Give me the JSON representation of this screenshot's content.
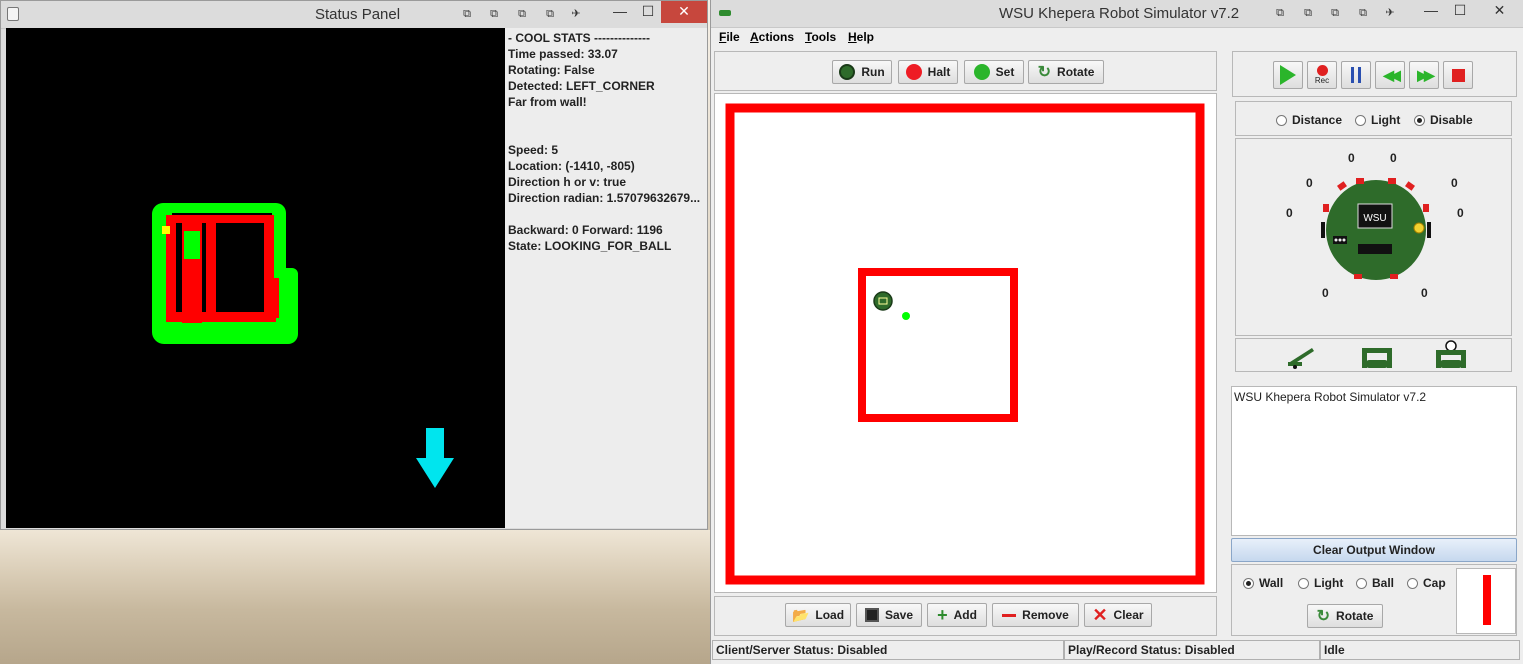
{
  "status_panel": {
    "title": "Status Panel",
    "stats": [
      "- COOL STATS --------------",
      "Time passed: 33.07",
      "Rotating: False",
      "Detected: LEFT_CORNER",
      "Far from wall!",
      "",
      "",
      "Speed: 5",
      "Location: (-1410, -805)",
      "Direction h or v: true",
      "Direction radian: 1.57079632679...",
      "",
      "Backward: 0 Forward: 1196",
      "State: LOOKING_FOR_BALL"
    ]
  },
  "simulator": {
    "title": "WSU Khepera Robot Simulator v7.2",
    "menu": [
      "File",
      "Actions",
      "Tools",
      "Help"
    ],
    "menu_mnemonics": [
      "F",
      "A",
      "T",
      "H"
    ],
    "top_buttons": {
      "run": "Run",
      "halt": "Halt",
      "set": "Set",
      "rotate": "Rotate"
    },
    "bottom_buttons": {
      "load": "Load",
      "save": "Save",
      "add": "Add",
      "remove": "Remove",
      "clear": "Clear"
    },
    "playback": {
      "rec_label": "Rec"
    },
    "sensor_mode": {
      "options": [
        "Distance",
        "Light",
        "Disable"
      ],
      "selected": "Disable"
    },
    "sensor_values": [
      "0",
      "0",
      "0",
      "0",
      "0",
      "0",
      "0",
      "0"
    ],
    "robot_label": "WSU",
    "output_text": "WSU Khepera Robot Simulator v7.2",
    "clear_output_label": "Clear Output Window",
    "object_type": {
      "options": [
        "Wall",
        "Light",
        "Ball",
        "Cap"
      ],
      "selected": "Wall"
    },
    "rotate_label": "Rotate",
    "status": {
      "client_server": "Client/Server Status: Disabled",
      "play_record": "Play/Record Status: Disabled",
      "state": "Idle"
    },
    "colors": {
      "wall": "#ff0000",
      "robot_green": "#2e6b2a",
      "found_green": "#00ff00",
      "arrow": "#00e5ee"
    }
  }
}
